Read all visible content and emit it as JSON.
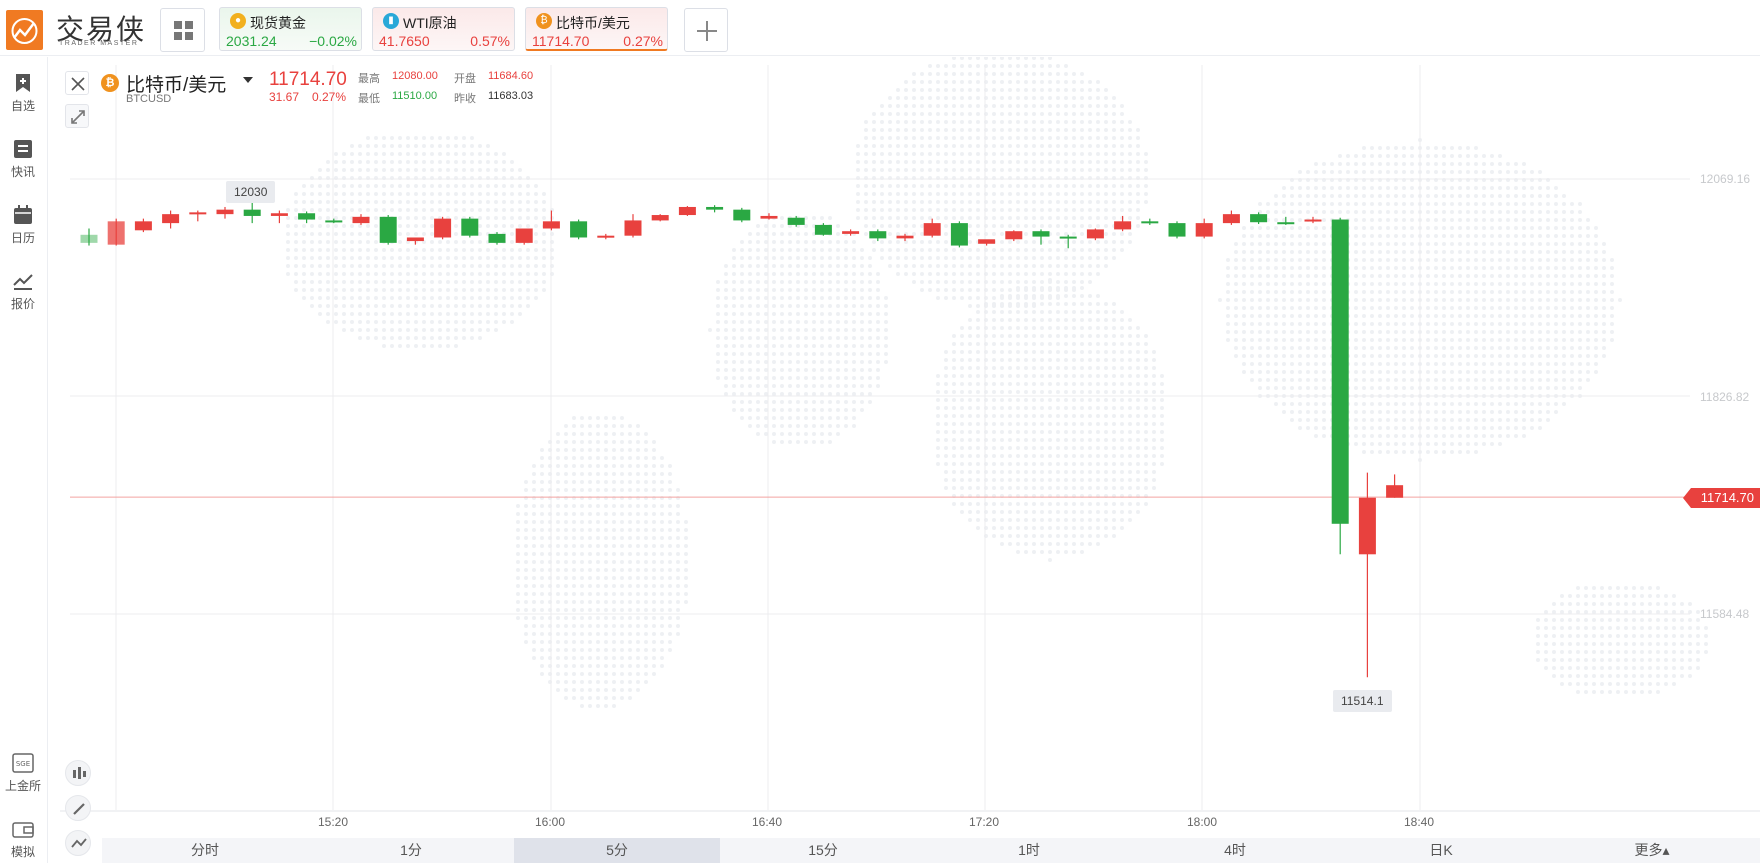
{
  "app": {
    "logo_text": "交易侠",
    "logo_sub": "TRADER MASTER"
  },
  "tickers": [
    {
      "name": "现货黄金",
      "price": "2031.24",
      "change": "−0.02%",
      "icon": "gold-coin-icon",
      "trend": "down"
    },
    {
      "name": "WTI原油",
      "price": "41.7650",
      "change": "0.57%",
      "icon": "oil-barrel-icon",
      "trend": "up"
    },
    {
      "name": "比特币/美元",
      "price": "11714.70",
      "change": "0.27%",
      "icon": "bitcoin-icon",
      "trend": "up",
      "active": true
    }
  ],
  "sidebar": {
    "items": [
      {
        "label": "自选",
        "icon": "bookmark-add-icon"
      },
      {
        "label": "快讯",
        "icon": "news-list-icon"
      },
      {
        "label": "日历",
        "icon": "calendar-icon"
      },
      {
        "label": "报价",
        "icon": "line-chart-icon"
      }
    ],
    "bottom_items": [
      {
        "label": "上金所",
        "icon": "sge-icon"
      },
      {
        "label": "模拟",
        "icon": "wallet-icon"
      }
    ]
  },
  "symbol": {
    "name": "比特币/美元",
    "code": "BTCUSD",
    "price": "11714.70",
    "change": "31.67",
    "change_pct": "0.27%",
    "stats": {
      "high_label": "最高",
      "high": "12080.00",
      "open_label": "开盘",
      "open": "11684.60",
      "low_label": "最低",
      "low": "11510.00",
      "prev_label": "昨收",
      "prev_close": "11683.03"
    }
  },
  "axis": {
    "y_labels": [
      "12069.16",
      "11826.82",
      "11584.48"
    ],
    "current_price": "11714.70",
    "x_labels": [
      "15:20",
      "16:00",
      "16:40",
      "17:20",
      "18:00",
      "18:40"
    ]
  },
  "annotations": {
    "high_marker": "12030",
    "low_marker": "11514.1"
  },
  "timeframes": [
    {
      "label": "分时"
    },
    {
      "label": "1分"
    },
    {
      "label": "5分",
      "active": true
    },
    {
      "label": "15分"
    },
    {
      "label": "1时"
    },
    {
      "label": "4时"
    },
    {
      "label": "日K"
    },
    {
      "label": "更多▴"
    }
  ],
  "colors": {
    "up": "#e8413e",
    "down": "#2aa843",
    "accent": "#f07a22"
  },
  "chart_data": {
    "type": "candlestick",
    "symbol": "BTCUSD",
    "interval": "5分",
    "x_ticks": [
      "15:20",
      "16:00",
      "16:40",
      "17:20",
      "18:00",
      "18:40"
    ],
    "y_ticks": [
      12069.16,
      11826.82,
      11584.48
    ],
    "ylim": [
      11450,
      12150
    ],
    "candles": [
      {
        "o": 12007,
        "h": 12014,
        "c": 11998,
        "l": 11995
      },
      {
        "o": 11996,
        "h": 12025,
        "c": 12022,
        "l": 11995
      },
      {
        "o": 12012,
        "h": 12025,
        "c": 12022,
        "l": 12010
      },
      {
        "o": 12020,
        "h": 12034,
        "c": 12030,
        "l": 12014
      },
      {
        "o": 12032,
        "h": 12034,
        "c": 12032,
        "l": 12022
      },
      {
        "o": 12030,
        "h": 12038,
        "c": 12035,
        "l": 12025
      },
      {
        "o": 12035,
        "h": 12048,
        "c": 12028,
        "l": 12020
      },
      {
        "o": 12028,
        "h": 12034,
        "c": 12031,
        "l": 12020
      },
      {
        "o": 12031,
        "h": 12033,
        "c": 12024,
        "l": 12020
      },
      {
        "o": 12023,
        "h": 12025,
        "c": 12021,
        "l": 12020
      },
      {
        "o": 12020,
        "h": 12030,
        "c": 12027,
        "l": 12018
      },
      {
        "o": 12027,
        "h": 12029,
        "c": 11998,
        "l": 11996
      },
      {
        "o": 12000,
        "h": 12003,
        "c": 12004,
        "l": 11996
      },
      {
        "o": 12004,
        "h": 12027,
        "c": 12025,
        "l": 12002
      },
      {
        "o": 12025,
        "h": 12027,
        "c": 12006,
        "l": 12004
      },
      {
        "o": 12008,
        "h": 12010,
        "c": 11998,
        "l": 11996
      },
      {
        "o": 11998,
        "h": 12012,
        "c": 12014,
        "l": 11996
      },
      {
        "o": 12014,
        "h": 12034,
        "c": 12022,
        "l": 12012
      },
      {
        "o": 12022,
        "h": 12024,
        "c": 12004,
        "l": 12002
      },
      {
        "o": 12004,
        "h": 12008,
        "c": 12006,
        "l": 12002
      },
      {
        "o": 12006,
        "h": 12030,
        "c": 12023,
        "l": 12004
      },
      {
        "o": 12023,
        "h": 12030,
        "c": 12029,
        "l": 12022
      },
      {
        "o": 12029,
        "h": 12039,
        "c": 12038,
        "l": 12028
      },
      {
        "o": 12038,
        "h": 12040,
        "c": 12035,
        "l": 12032
      },
      {
        "o": 12035,
        "h": 12037,
        "c": 12023,
        "l": 12021
      },
      {
        "o": 12025,
        "h": 12031,
        "c": 12028,
        "l": 12024
      },
      {
        "o": 12026,
        "h": 12028,
        "c": 12018,
        "l": 12016
      },
      {
        "o": 12018,
        "h": 12020,
        "c": 12007,
        "l": 12006
      },
      {
        "o": 12008,
        "h": 12013,
        "c": 12011,
        "l": 12006
      },
      {
        "o": 12011,
        "h": 12013,
        "c": 12003,
        "l": 12000
      },
      {
        "o": 12003,
        "h": 12008,
        "c": 12006,
        "l": 12000
      },
      {
        "o": 12006,
        "h": 12025,
        "c": 12020,
        "l": 12004
      },
      {
        "o": 12020,
        "h": 12022,
        "c": 11995,
        "l": 11993
      },
      {
        "o": 11997,
        "h": 11999,
        "c": 12002,
        "l": 11995
      },
      {
        "o": 12002,
        "h": 12012,
        "c": 12011,
        "l": 12000
      },
      {
        "o": 12011,
        "h": 12013,
        "c": 12005,
        "l": 11996
      },
      {
        "o": 12005,
        "h": 12007,
        "c": 12003,
        "l": 11992
      },
      {
        "o": 12003,
        "h": 12014,
        "c": 12013,
        "l": 12001
      },
      {
        "o": 12013,
        "h": 12028,
        "c": 12022,
        "l": 12011
      },
      {
        "o": 12022,
        "h": 12025,
        "c": 12020,
        "l": 12018
      },
      {
        "o": 12020,
        "h": 12022,
        "c": 12005,
        "l": 12003
      },
      {
        "o": 12005,
        "h": 12025,
        "c": 12020,
        "l": 12003
      },
      {
        "o": 12020,
        "h": 12034,
        "c": 12030,
        "l": 12018
      },
      {
        "o": 12030,
        "h": 12032,
        "c": 12021,
        "l": 12019
      },
      {
        "o": 12021,
        "h": 12027,
        "c": 12020,
        "l": 12018
      },
      {
        "o": 12022,
        "h": 12027,
        "c": 12024,
        "l": 12020
      },
      {
        "o": 12024,
        "h": 12026,
        "c": 11685,
        "l": 11651
      },
      {
        "o": 11651,
        "h": 11742,
        "c": 11714,
        "l": 11514
      },
      {
        "o": 11714,
        "h": 11740,
        "c": 11728,
        "l": 11714
      }
    ]
  }
}
